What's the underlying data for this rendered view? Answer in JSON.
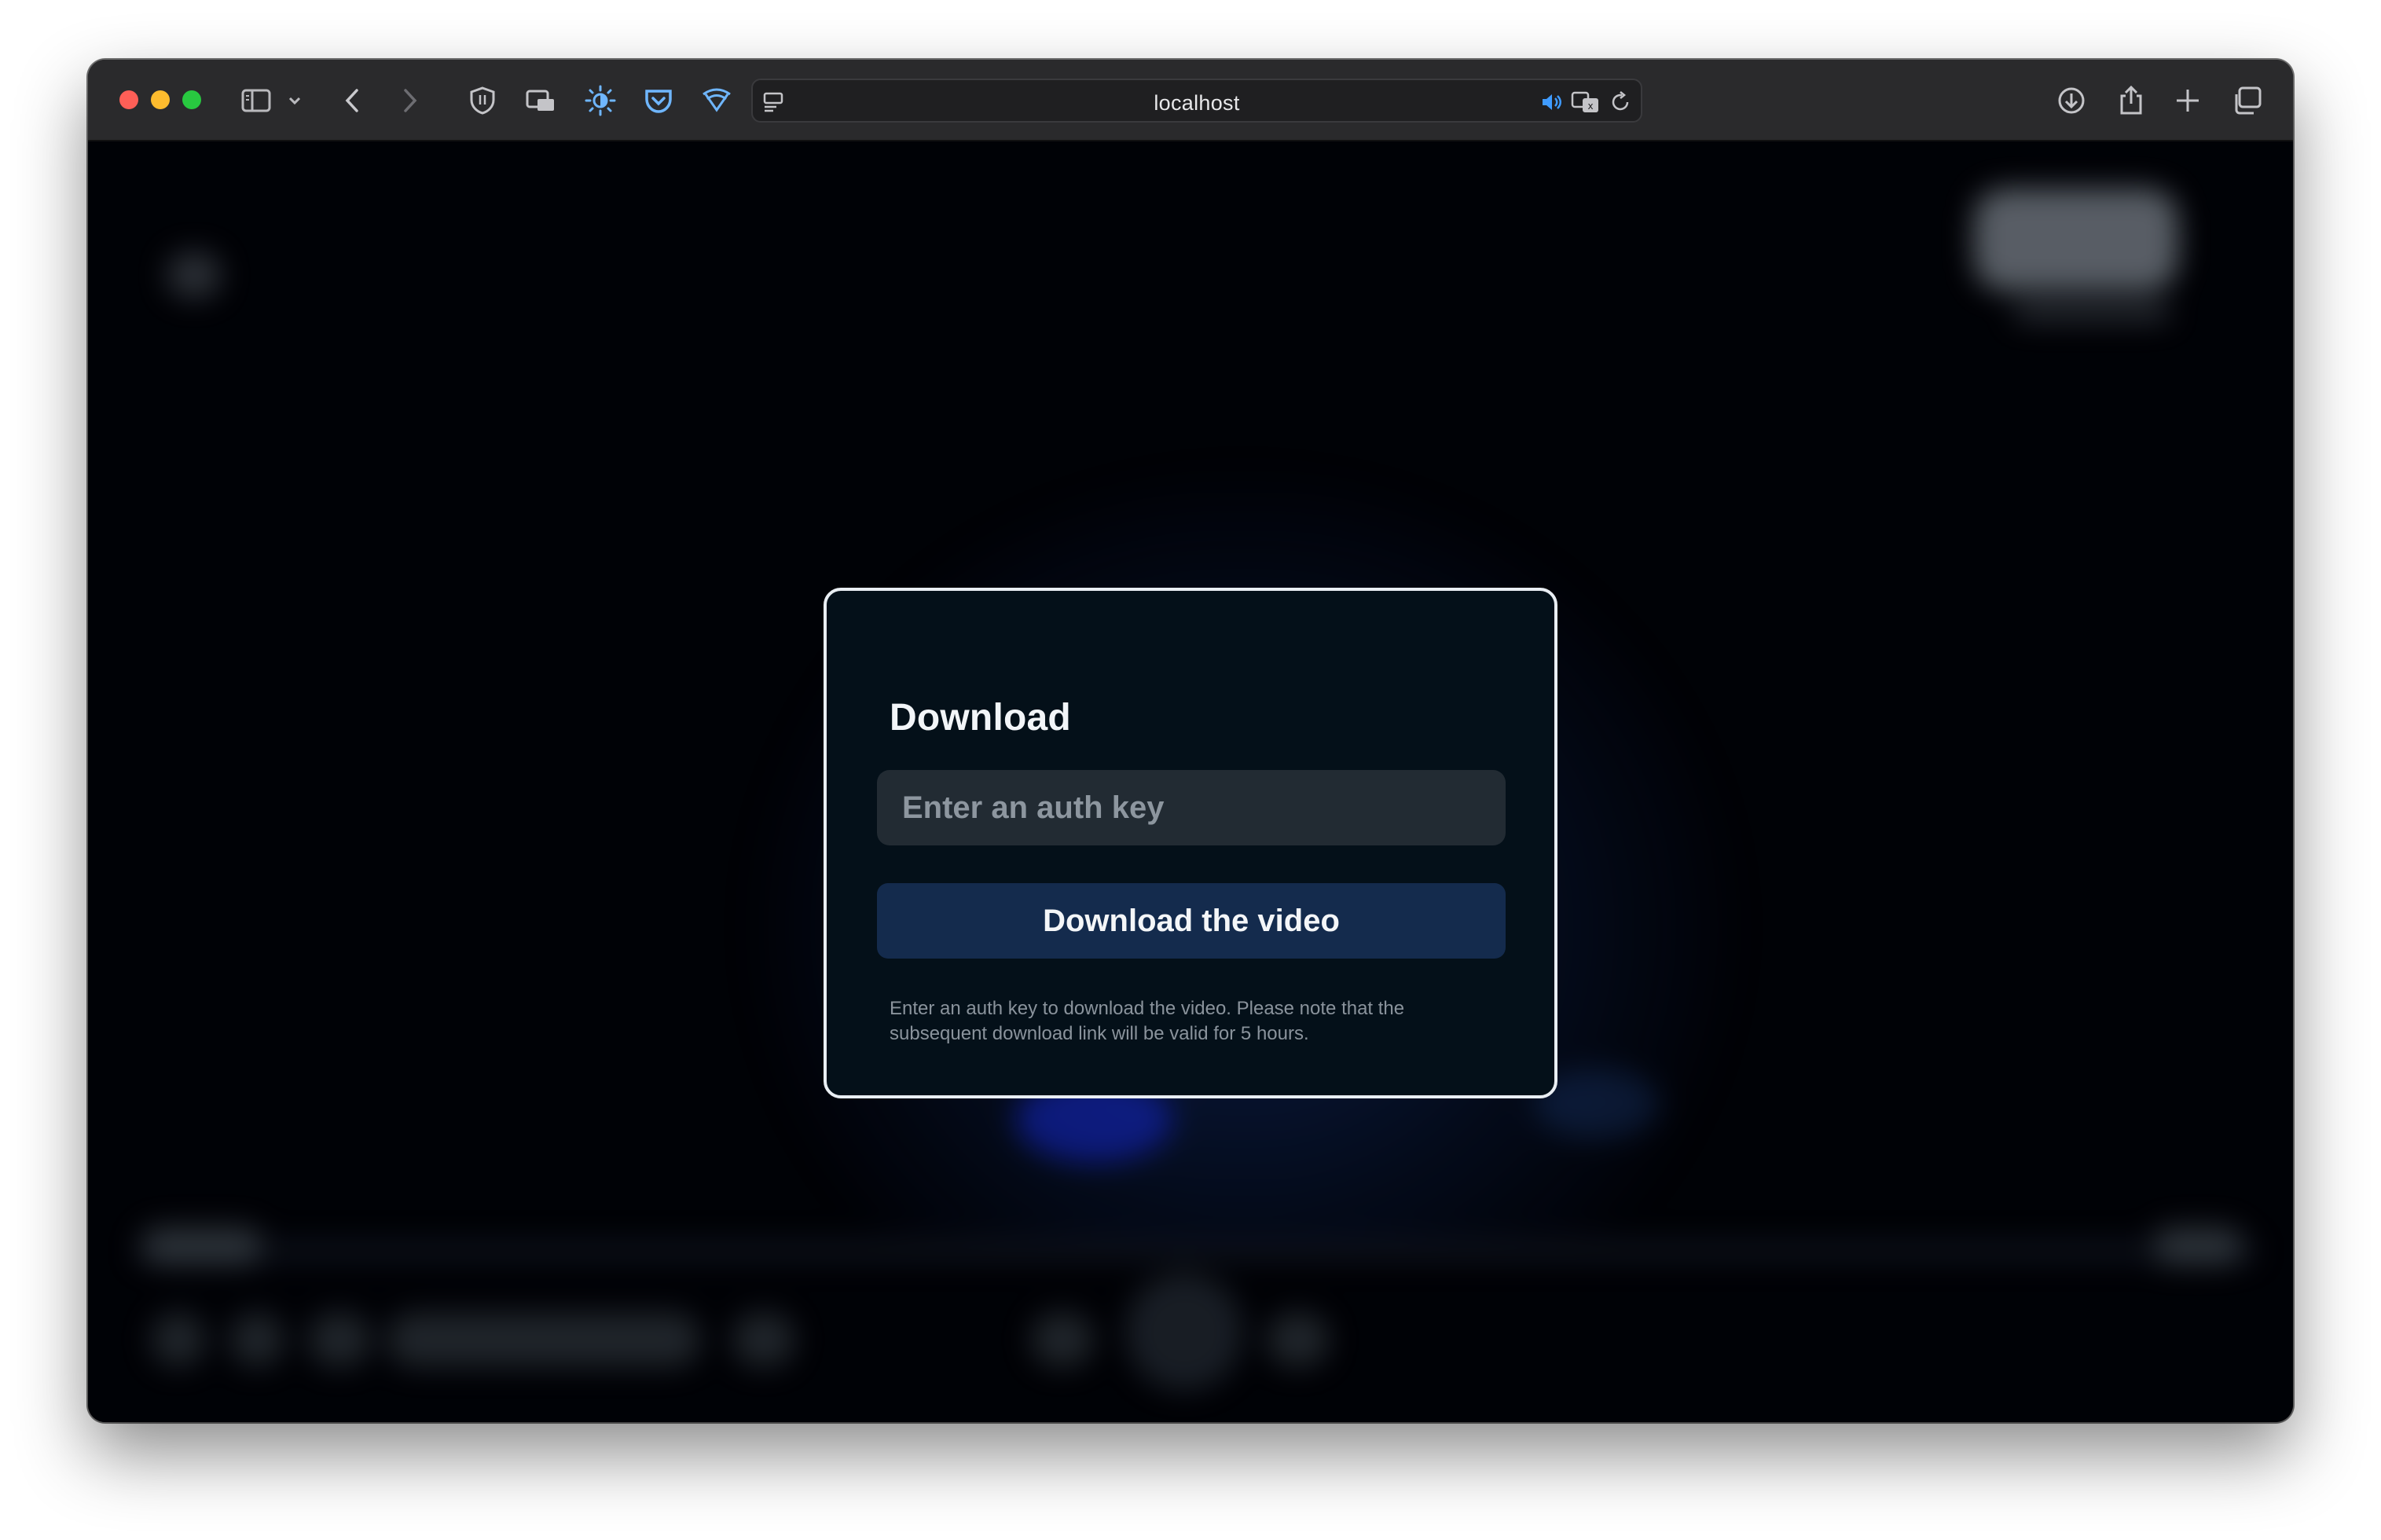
{
  "browser": {
    "url": "localhost",
    "icons": {
      "sidebar": "sidebar-icon",
      "chevron": "chevron-down-icon",
      "back": "back-arrow-icon",
      "forward": "forward-arrow-icon",
      "shield": "shield-icon",
      "picture_in_picture": "picture-in-picture-icon",
      "brightness": "brightness-icon",
      "pocket": "pocket-icon",
      "wifi_shield": "wifi-shield-icon",
      "reader": "reader-icon",
      "audio": "speaker-icon",
      "translate": "translate-icon",
      "reload": "reload-icon",
      "download": "download-icon",
      "share": "share-icon",
      "new_tab": "plus-icon",
      "tabs": "tab-overview-icon"
    }
  },
  "modal": {
    "title": "Download",
    "input_placeholder": "Enter an auth key",
    "input_value": "",
    "button_label": "Download the video",
    "help_text": "Enter an auth key to download the video. Please note that the subsequent download link will be valid for 5 hours."
  },
  "colors": {
    "modal_bg": "#041019",
    "modal_border": "#e9eef3",
    "input_bg": "#222b33",
    "button_bg": "#142b4d",
    "page_bg": "#000206"
  }
}
